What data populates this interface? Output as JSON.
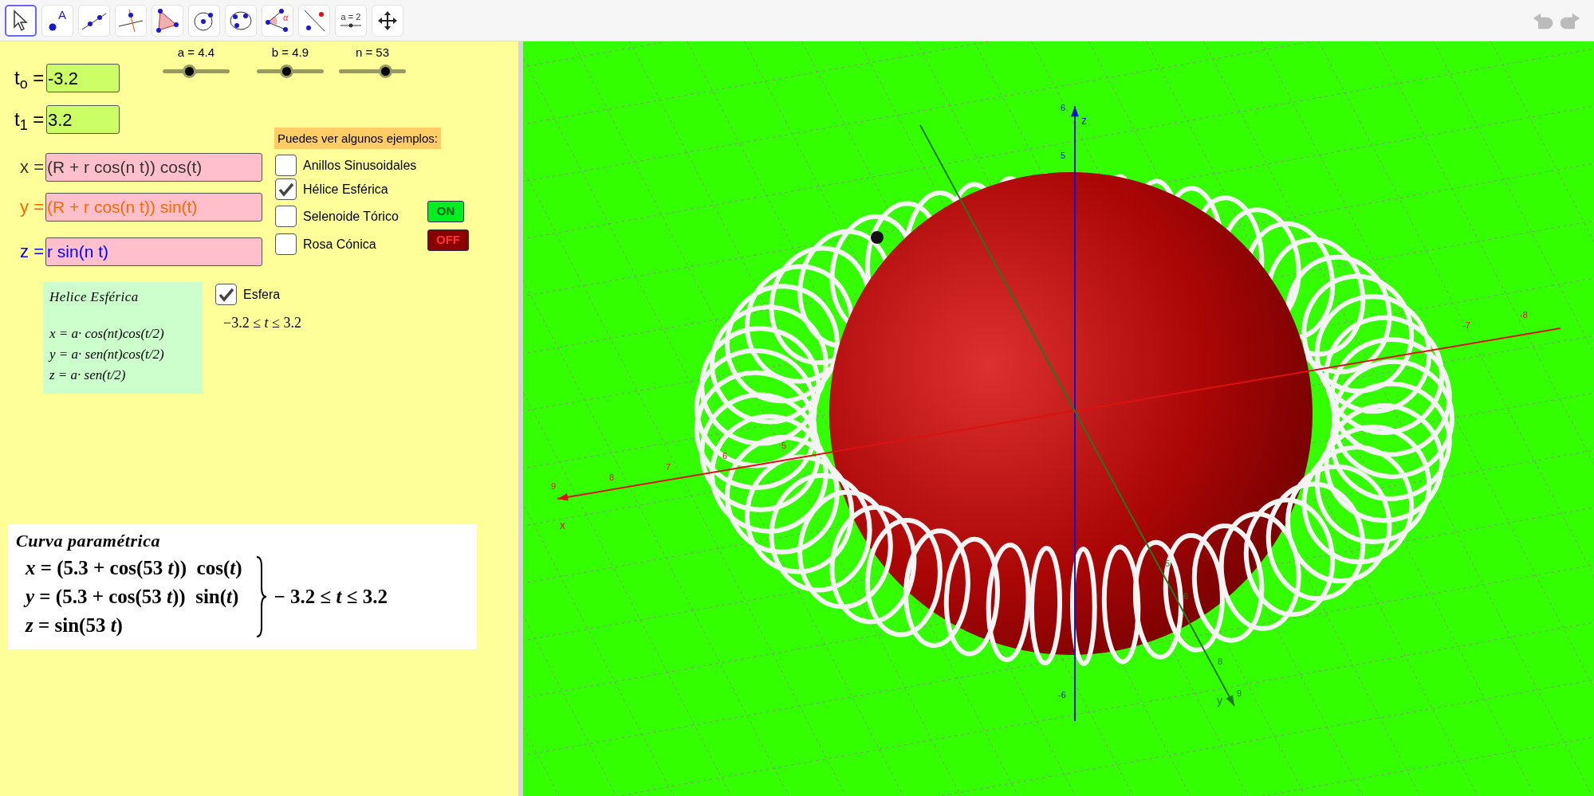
{
  "toolbar": {
    "tools": [
      {
        "kind": "move",
        "selected": true
      },
      {
        "kind": "point",
        "selected": false,
        "label": "A"
      },
      {
        "kind": "line",
        "selected": false
      },
      {
        "kind": "perpendicular",
        "selected": false
      },
      {
        "kind": "polygon",
        "selected": false
      },
      {
        "kind": "circle",
        "selected": false
      },
      {
        "kind": "conic",
        "selected": false
      },
      {
        "kind": "angle",
        "selected": false,
        "label": "α"
      },
      {
        "kind": "reflect",
        "selected": false
      },
      {
        "kind": "slider",
        "selected": false,
        "label": "a = 2"
      },
      {
        "kind": "move_view",
        "selected": false
      }
    ]
  },
  "sliders": [
    {
      "label": "a = 4.4",
      "level": 0.37
    },
    {
      "label": "b = 4.9",
      "level": 0.44
    },
    {
      "label": "n = 53",
      "level": 0.74
    }
  ],
  "interval": [
    {
      "label": "t$_{o}$ =",
      "value": "-3.2"
    },
    {
      "label": "t$_{1}$ =",
      "value": "3.2"
    }
  ],
  "equations": [
    {
      "label": "x =",
      "value": "(R + r cos(n t)) cos(t)",
      "color": "#333333"
    },
    {
      "label": "y =",
      "value": "(R + r cos(n t)) sin(t)",
      "color": "#ff6600"
    },
    {
      "label": "z =",
      "value": "r sin(n t)",
      "color": "#0000ff"
    }
  ],
  "examples": {
    "title": "Puedes ver algunos ejemplos:",
    "items": [
      {
        "label": "Anillos Sinusoidales",
        "checked": false
      },
      {
        "label": "Hélice Esférica",
        "checked": true
      },
      {
        "label": "Selenoide Tórico",
        "checked": false
      },
      {
        "label": "Rosa Cónica",
        "checked": false
      }
    ]
  },
  "toggle_buttons": [
    {
      "label": "ON",
      "kind": "on"
    },
    {
      "label": "OFF",
      "kind": "off"
    }
  ],
  "helix_card": {
    "title": "Helice Esférica",
    "lines": [
      "x = a· cos(nt)cos(t/2)",
      "y = a· sen(nt)cos(t/2)",
      "z = a· sen(t/2)"
    ]
  },
  "sphere_toggle": {
    "label": "Esfera",
    "checked": true
  },
  "range_text": "−3.2 ≤ *t* ≤ 3.2",
  "formula_card": {
    "title": "Curva paramétrica",
    "lines": [
      "*x* = (5.3 + cos(53 *t*))  cos(*t*)",
      "*y* = (5.3 + cos(53 *t*))  sin(*t*)",
      "*z* = sin(53 *t*)"
    ],
    "range": "− 3.2 ≤ *t* ≤ 3.2"
  },
  "view3d": {
    "axes": [
      {
        "name": "x",
        "ticks": [
          "9",
          "8",
          "7",
          "6",
          "5",
          "-7",
          "-8"
        ]
      },
      {
        "name": "z",
        "ticks": [
          "6",
          "5",
          "-6"
        ]
      },
      {
        "name": "y",
        "ticks": [
          "5",
          "6",
          "8",
          "9"
        ]
      }
    ]
  }
}
